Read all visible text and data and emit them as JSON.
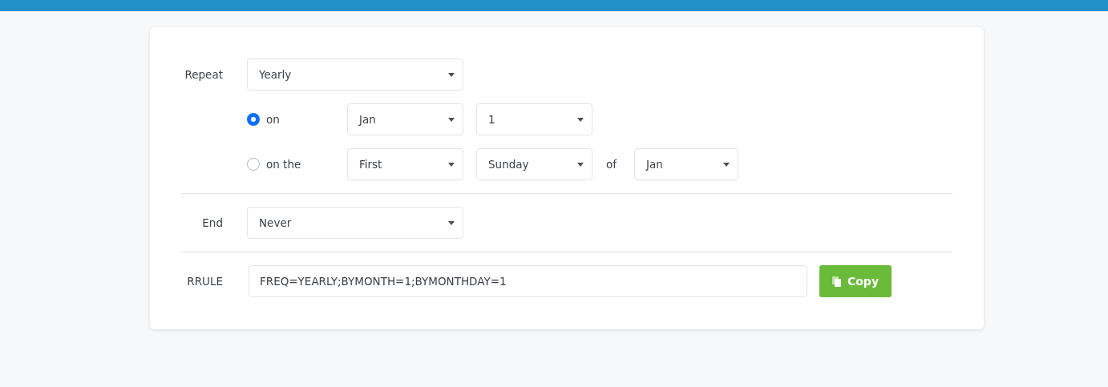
{
  "repeat": {
    "label": "Repeat",
    "value": "Yearly"
  },
  "repeat_options": [
    {
      "label": "on",
      "selected": true,
      "fields": [
        {
          "kind": "select",
          "value": "Jan"
        },
        {
          "kind": "select",
          "value": "1"
        }
      ]
    },
    {
      "label": "on the",
      "selected": false,
      "fields": [
        {
          "kind": "select",
          "value": "First"
        },
        {
          "kind": "select",
          "value": "Sunday"
        },
        {
          "kind": "text",
          "text": "of"
        },
        {
          "kind": "select",
          "value": "Jan"
        }
      ]
    }
  ],
  "end": {
    "label": "End",
    "value": "Never"
  },
  "rrule": {
    "label": "RRULE",
    "value": "FREQ=YEARLY;BYMONTH=1;BYMONTHDAY=1"
  },
  "copy_button": {
    "label": "Copy"
  }
}
